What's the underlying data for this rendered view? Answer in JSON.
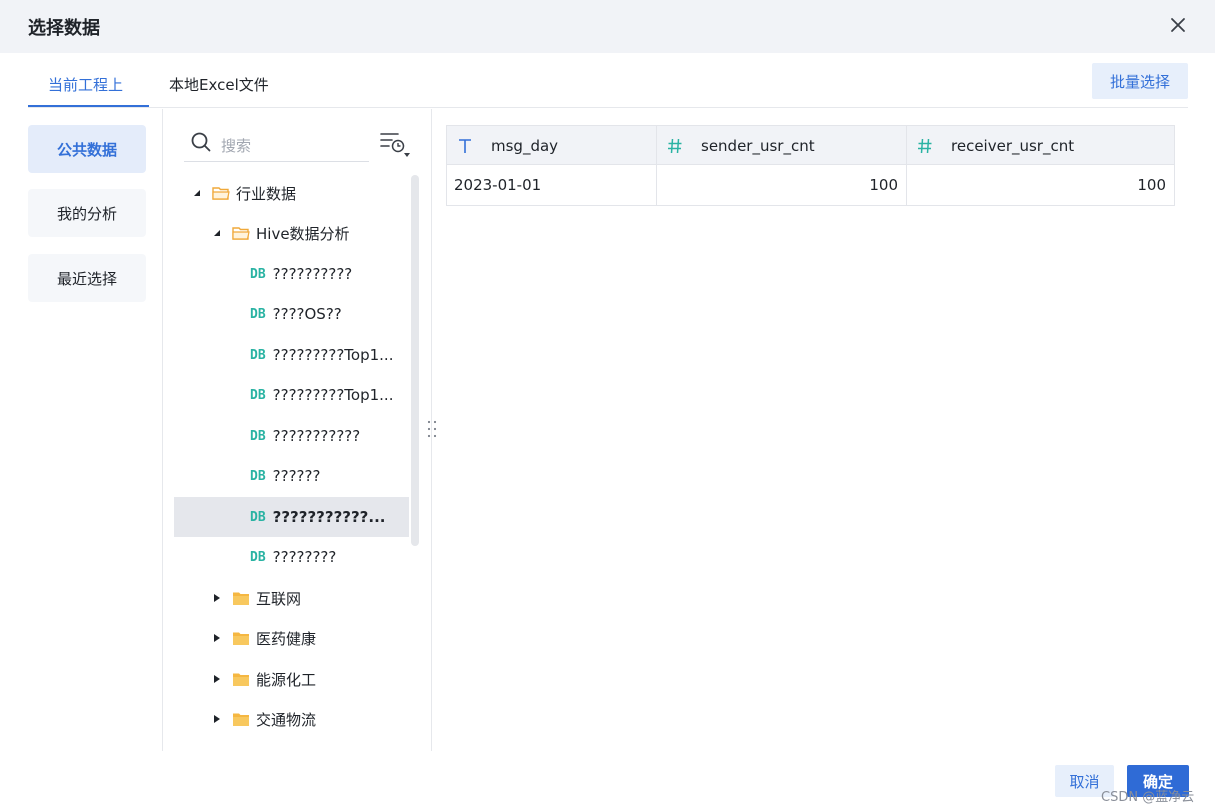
{
  "dialog": {
    "title": "选择数据"
  },
  "tabs": [
    {
      "label": "当前工程上",
      "active": true
    },
    {
      "label": "本地Excel文件",
      "active": false
    }
  ],
  "toolbar": {
    "batch_select_label": "批量选择"
  },
  "sidebar": {
    "items": [
      {
        "label": "公共数据",
        "active": true
      },
      {
        "label": "我的分析",
        "active": false
      },
      {
        "label": "最近选择",
        "active": false
      }
    ]
  },
  "search": {
    "placeholder": "搜索"
  },
  "tree": {
    "root": {
      "label": "行业数据",
      "expanded": true
    },
    "hive": {
      "label": "Hive数据分析",
      "expanded": true
    },
    "tables": [
      {
        "label": "??????????"
      },
      {
        "label": "????OS??"
      },
      {
        "label": "?????????Top1..."
      },
      {
        "label": "?????????Top1..."
      },
      {
        "label": "???????????"
      },
      {
        "label": "??????"
      },
      {
        "label": "???????????...",
        "selected": true
      },
      {
        "label": "????????"
      }
    ],
    "db_badge": "DB",
    "folders": [
      {
        "label": "互联网"
      },
      {
        "label": "医药健康"
      },
      {
        "label": "能源化工"
      },
      {
        "label": "交通物流"
      }
    ]
  },
  "grid": {
    "columns": [
      {
        "name": "msg_day",
        "type": "text"
      },
      {
        "name": "sender_usr_cnt",
        "type": "number"
      },
      {
        "name": "receiver_usr_cnt",
        "type": "number"
      }
    ],
    "rows": [
      [
        "2023-01-01",
        "100",
        "100"
      ]
    ]
  },
  "footer": {
    "cancel_label": "取消",
    "confirm_label": "确定"
  },
  "watermark": "CSDN @蓝净云",
  "colors": {
    "accent": "#3370d8",
    "db_badge": "#2ab3a3",
    "folder": "#f5b742"
  }
}
